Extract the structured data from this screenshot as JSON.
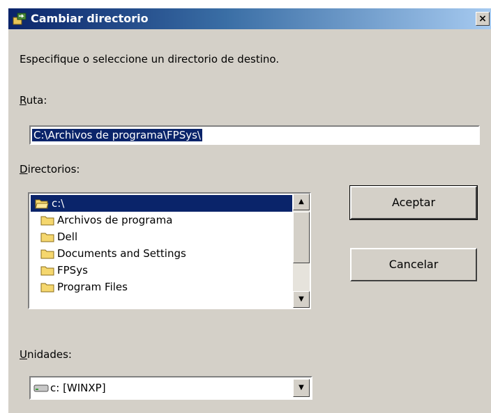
{
  "window": {
    "title": "Cambiar directorio",
    "close_glyph": "×",
    "icon": "change-directory-icon"
  },
  "prompt": "Especifique o seleccione un directorio de destino.",
  "ruta": {
    "label_accel": "R",
    "label_rest": "uta:",
    "value": "C:\\Archivos de programa\\FPSys\\"
  },
  "directories": {
    "label_accel": "D",
    "label_rest": "irectorios:",
    "items": [
      {
        "label": "c:\\",
        "icon": "open-folder-icon",
        "selected": true
      },
      {
        "label": "Archivos de programa",
        "icon": "folder-icon",
        "selected": false
      },
      {
        "label": "Dell",
        "icon": "folder-icon",
        "selected": false
      },
      {
        "label": "Documents and Settings",
        "icon": "folder-icon",
        "selected": false
      },
      {
        "label": "FPSys",
        "icon": "folder-icon",
        "selected": false
      },
      {
        "label": "Program Files",
        "icon": "folder-icon",
        "selected": false
      }
    ],
    "scroll_up_glyph": "▲",
    "scroll_down_glyph": "▼"
  },
  "buttons": {
    "accept": "Aceptar",
    "cancel": "Cancelar"
  },
  "drives": {
    "label_accel": "U",
    "label_rest": "nidades:",
    "selected": "c: [WINXP]",
    "icon": "drive-icon",
    "dropdown_glyph": "▼"
  },
  "colors": {
    "dialog_bg": "#d4d0c8",
    "title_start": "#0a246a",
    "title_end": "#a6caf0",
    "selection": "#0a246a"
  }
}
